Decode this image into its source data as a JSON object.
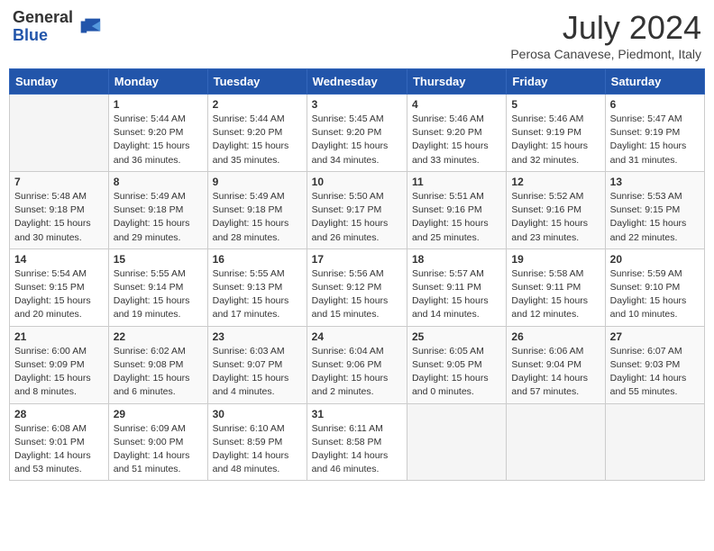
{
  "header": {
    "logo_general": "General",
    "logo_blue": "Blue",
    "title": "July 2024",
    "location": "Perosa Canavese, Piedmont, Italy"
  },
  "days_of_week": [
    "Sunday",
    "Monday",
    "Tuesday",
    "Wednesday",
    "Thursday",
    "Friday",
    "Saturday"
  ],
  "weeks": [
    [
      {
        "day": "",
        "sunrise": "",
        "sunset": "",
        "daylight": ""
      },
      {
        "day": "1",
        "sunrise": "Sunrise: 5:44 AM",
        "sunset": "Sunset: 9:20 PM",
        "daylight": "Daylight: 15 hours and 36 minutes."
      },
      {
        "day": "2",
        "sunrise": "Sunrise: 5:44 AM",
        "sunset": "Sunset: 9:20 PM",
        "daylight": "Daylight: 15 hours and 35 minutes."
      },
      {
        "day": "3",
        "sunrise": "Sunrise: 5:45 AM",
        "sunset": "Sunset: 9:20 PM",
        "daylight": "Daylight: 15 hours and 34 minutes."
      },
      {
        "day": "4",
        "sunrise": "Sunrise: 5:46 AM",
        "sunset": "Sunset: 9:20 PM",
        "daylight": "Daylight: 15 hours and 33 minutes."
      },
      {
        "day": "5",
        "sunrise": "Sunrise: 5:46 AM",
        "sunset": "Sunset: 9:19 PM",
        "daylight": "Daylight: 15 hours and 32 minutes."
      },
      {
        "day": "6",
        "sunrise": "Sunrise: 5:47 AM",
        "sunset": "Sunset: 9:19 PM",
        "daylight": "Daylight: 15 hours and 31 minutes."
      }
    ],
    [
      {
        "day": "7",
        "sunrise": "Sunrise: 5:48 AM",
        "sunset": "Sunset: 9:18 PM",
        "daylight": "Daylight: 15 hours and 30 minutes."
      },
      {
        "day": "8",
        "sunrise": "Sunrise: 5:49 AM",
        "sunset": "Sunset: 9:18 PM",
        "daylight": "Daylight: 15 hours and 29 minutes."
      },
      {
        "day": "9",
        "sunrise": "Sunrise: 5:49 AM",
        "sunset": "Sunset: 9:18 PM",
        "daylight": "Daylight: 15 hours and 28 minutes."
      },
      {
        "day": "10",
        "sunrise": "Sunrise: 5:50 AM",
        "sunset": "Sunset: 9:17 PM",
        "daylight": "Daylight: 15 hours and 26 minutes."
      },
      {
        "day": "11",
        "sunrise": "Sunrise: 5:51 AM",
        "sunset": "Sunset: 9:16 PM",
        "daylight": "Daylight: 15 hours and 25 minutes."
      },
      {
        "day": "12",
        "sunrise": "Sunrise: 5:52 AM",
        "sunset": "Sunset: 9:16 PM",
        "daylight": "Daylight: 15 hours and 23 minutes."
      },
      {
        "day": "13",
        "sunrise": "Sunrise: 5:53 AM",
        "sunset": "Sunset: 9:15 PM",
        "daylight": "Daylight: 15 hours and 22 minutes."
      }
    ],
    [
      {
        "day": "14",
        "sunrise": "Sunrise: 5:54 AM",
        "sunset": "Sunset: 9:15 PM",
        "daylight": "Daylight: 15 hours and 20 minutes."
      },
      {
        "day": "15",
        "sunrise": "Sunrise: 5:55 AM",
        "sunset": "Sunset: 9:14 PM",
        "daylight": "Daylight: 15 hours and 19 minutes."
      },
      {
        "day": "16",
        "sunrise": "Sunrise: 5:55 AM",
        "sunset": "Sunset: 9:13 PM",
        "daylight": "Daylight: 15 hours and 17 minutes."
      },
      {
        "day": "17",
        "sunrise": "Sunrise: 5:56 AM",
        "sunset": "Sunset: 9:12 PM",
        "daylight": "Daylight: 15 hours and 15 minutes."
      },
      {
        "day": "18",
        "sunrise": "Sunrise: 5:57 AM",
        "sunset": "Sunset: 9:11 PM",
        "daylight": "Daylight: 15 hours and 14 minutes."
      },
      {
        "day": "19",
        "sunrise": "Sunrise: 5:58 AM",
        "sunset": "Sunset: 9:11 PM",
        "daylight": "Daylight: 15 hours and 12 minutes."
      },
      {
        "day": "20",
        "sunrise": "Sunrise: 5:59 AM",
        "sunset": "Sunset: 9:10 PM",
        "daylight": "Daylight: 15 hours and 10 minutes."
      }
    ],
    [
      {
        "day": "21",
        "sunrise": "Sunrise: 6:00 AM",
        "sunset": "Sunset: 9:09 PM",
        "daylight": "Daylight: 15 hours and 8 minutes."
      },
      {
        "day": "22",
        "sunrise": "Sunrise: 6:02 AM",
        "sunset": "Sunset: 9:08 PM",
        "daylight": "Daylight: 15 hours and 6 minutes."
      },
      {
        "day": "23",
        "sunrise": "Sunrise: 6:03 AM",
        "sunset": "Sunset: 9:07 PM",
        "daylight": "Daylight: 15 hours and 4 minutes."
      },
      {
        "day": "24",
        "sunrise": "Sunrise: 6:04 AM",
        "sunset": "Sunset: 9:06 PM",
        "daylight": "Daylight: 15 hours and 2 minutes."
      },
      {
        "day": "25",
        "sunrise": "Sunrise: 6:05 AM",
        "sunset": "Sunset: 9:05 PM",
        "daylight": "Daylight: 15 hours and 0 minutes."
      },
      {
        "day": "26",
        "sunrise": "Sunrise: 6:06 AM",
        "sunset": "Sunset: 9:04 PM",
        "daylight": "Daylight: 14 hours and 57 minutes."
      },
      {
        "day": "27",
        "sunrise": "Sunrise: 6:07 AM",
        "sunset": "Sunset: 9:03 PM",
        "daylight": "Daylight: 14 hours and 55 minutes."
      }
    ],
    [
      {
        "day": "28",
        "sunrise": "Sunrise: 6:08 AM",
        "sunset": "Sunset: 9:01 PM",
        "daylight": "Daylight: 14 hours and 53 minutes."
      },
      {
        "day": "29",
        "sunrise": "Sunrise: 6:09 AM",
        "sunset": "Sunset: 9:00 PM",
        "daylight": "Daylight: 14 hours and 51 minutes."
      },
      {
        "day": "30",
        "sunrise": "Sunrise: 6:10 AM",
        "sunset": "Sunset: 8:59 PM",
        "daylight": "Daylight: 14 hours and 48 minutes."
      },
      {
        "day": "31",
        "sunrise": "Sunrise: 6:11 AM",
        "sunset": "Sunset: 8:58 PM",
        "daylight": "Daylight: 14 hours and 46 minutes."
      },
      {
        "day": "",
        "sunrise": "",
        "sunset": "",
        "daylight": ""
      },
      {
        "day": "",
        "sunrise": "",
        "sunset": "",
        "daylight": ""
      },
      {
        "day": "",
        "sunrise": "",
        "sunset": "",
        "daylight": ""
      }
    ]
  ]
}
